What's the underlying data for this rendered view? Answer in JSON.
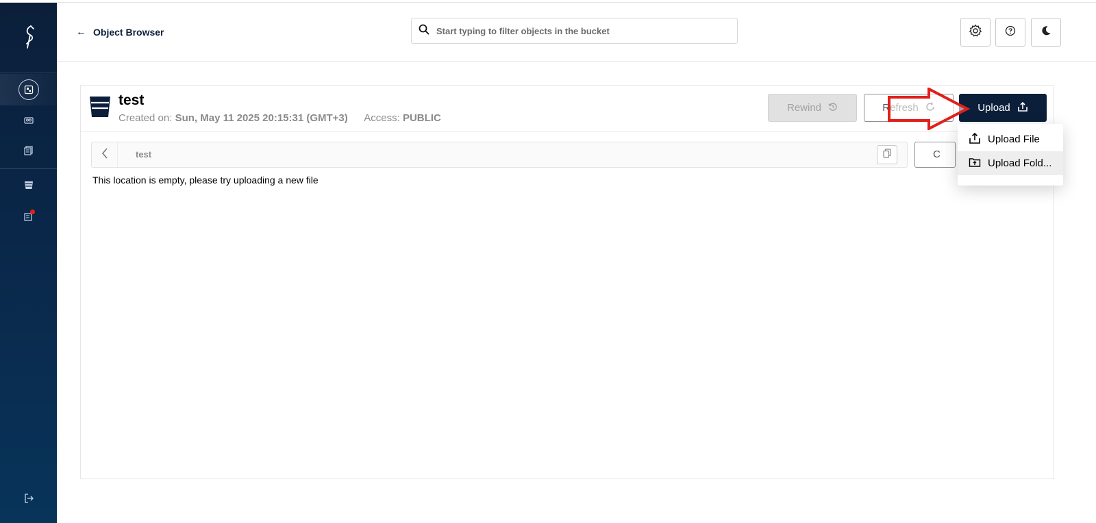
{
  "header": {
    "back_label": "Object Browser",
    "search_placeholder": "Start typing to filter objects in the bucket"
  },
  "sidebar": {
    "items": [
      {
        "name": "object-browser",
        "icon": "object-browser-icon",
        "active": true
      },
      {
        "name": "access-keys",
        "icon": "identity-icon",
        "active": false
      },
      {
        "name": "documentation",
        "icon": "documentation-icon",
        "active": false
      },
      {
        "name": "buckets",
        "icon": "bucket-icon",
        "active": false
      },
      {
        "name": "license",
        "icon": "license-icon",
        "active": false,
        "badge": true
      },
      {
        "name": "logout",
        "icon": "logout-icon",
        "active": false
      }
    ]
  },
  "bucket": {
    "name": "test",
    "created_label": "Created on:",
    "created_value": "Sun, May 11 2025 20:15:31 (GMT+3)",
    "access_label": "Access:",
    "access_value": "PUBLIC"
  },
  "toolbar": {
    "rewind_label": "Rewind",
    "refresh_label": "Refresh",
    "upload_label": "Upload",
    "partial_button_label": "C"
  },
  "breadcrumb": {
    "path": "test"
  },
  "main": {
    "empty_message": "This location is empty, please try uploading a new file"
  },
  "upload_menu": {
    "items": [
      {
        "label": "Upload File",
        "icon": "upload-file-icon"
      },
      {
        "label": "Upload Fold...",
        "icon": "upload-folder-icon"
      }
    ]
  },
  "colors": {
    "sidebar_bg": "#0b1f3a",
    "primary": "#0b1f3a",
    "annotation_red": "#e0201b",
    "badge_red": "#e0201b"
  }
}
